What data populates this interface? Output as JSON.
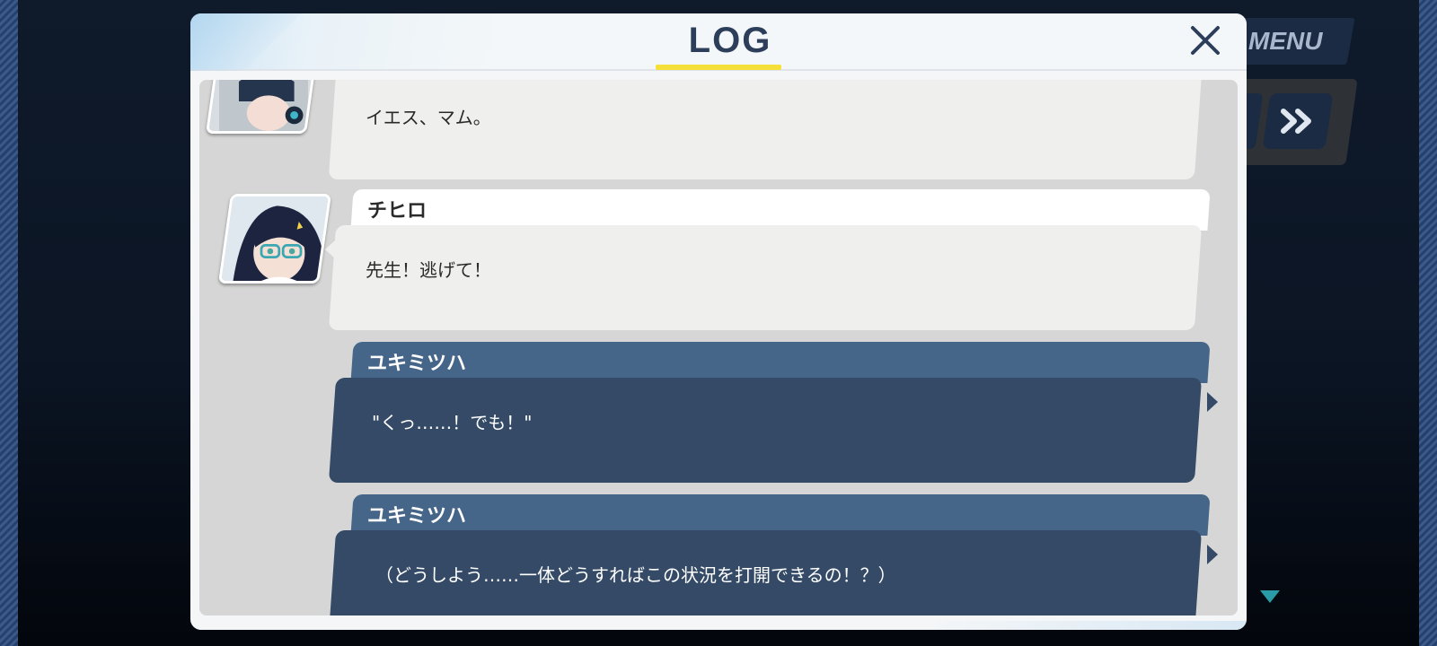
{
  "log_panel": {
    "title": "LOG",
    "close_icon": "close-icon"
  },
  "messages": [
    {
      "speaker": "",
      "text": "イエス、マム。",
      "style": "other",
      "avatar": "avatar-visor-girl"
    },
    {
      "speaker": "チヒロ",
      "text": "先生！逃げて！",
      "style": "other",
      "avatar": "avatar-chihiro"
    },
    {
      "speaker": "ユキミツハ",
      "text": "\"くっ……！でも！\"",
      "style": "self"
    },
    {
      "speaker": "ユキミツハ",
      "text": "（どうしよう……一体どうすればこの状況を打開できるの！？）",
      "style": "self"
    }
  ],
  "controls": {
    "menu_label": "MENU",
    "fast_forward_icon": "fast-forward-icon",
    "next_icon": "triangle-down-icon"
  },
  "colors": {
    "accent_yellow": "#f5e03a",
    "self_bubble": "#344a66",
    "self_name_tab": "#456589",
    "other_bubble": "#efefed",
    "title_text": "#2c3e5a"
  }
}
